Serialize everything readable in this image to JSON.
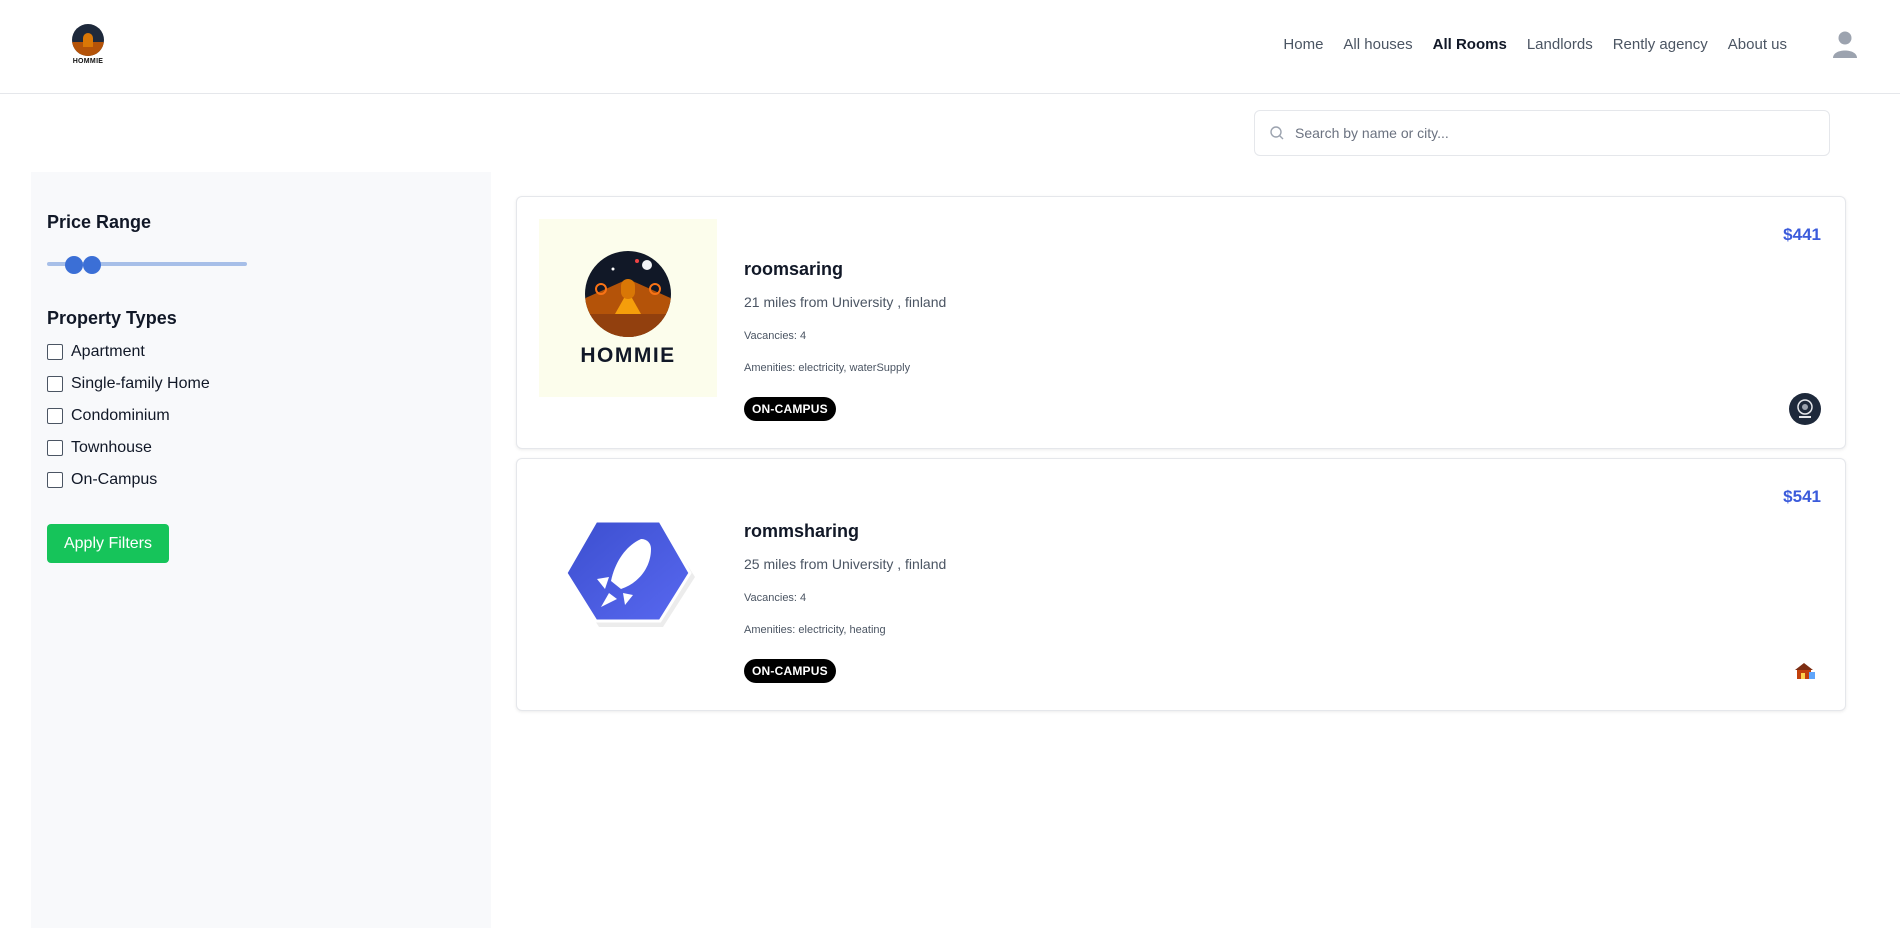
{
  "header": {
    "logo_text": "HOMMIE",
    "nav": [
      {
        "label": "Home",
        "active": false
      },
      {
        "label": "All houses",
        "active": false
      },
      {
        "label": "All Rooms",
        "active": true
      },
      {
        "label": "Landlords",
        "active": false
      },
      {
        "label": "Rently agency",
        "active": false
      },
      {
        "label": "About us",
        "active": false
      }
    ]
  },
  "search": {
    "placeholder": "Search by name or city..."
  },
  "filters": {
    "price_title": "Price Range",
    "price_range": {
      "min_fraction": 0.1,
      "max_fraction": 0.2
    },
    "types_title": "Property Types",
    "types": [
      "Apartment",
      "Single-family Home",
      "Condominium",
      "Townhouse",
      "On-Campus"
    ],
    "apply_label": "Apply Filters"
  },
  "listings": [
    {
      "title": "roomsaring",
      "distance": "21 miles from University , finland",
      "vacancies": "Vacancies: 4",
      "amenities": "Amenities: electricity, waterSupply",
      "badge": "ON-CAMPUS",
      "price": "$441",
      "thumb_icon": "hommie-logo-icon",
      "thumb_text": "HOMMIE"
    },
    {
      "title": "rommsharing",
      "distance": "25 miles from University , finland",
      "vacancies": "Vacancies: 4",
      "amenities": "Amenities: electricity, heating",
      "badge": "ON-CAMPUS",
      "price": "$541",
      "thumb_icon": "rocket-hexagon-icon"
    }
  ],
  "colors": {
    "accent": "#3b5bdb",
    "apply": "#16c45a",
    "badge": "#000000"
  }
}
